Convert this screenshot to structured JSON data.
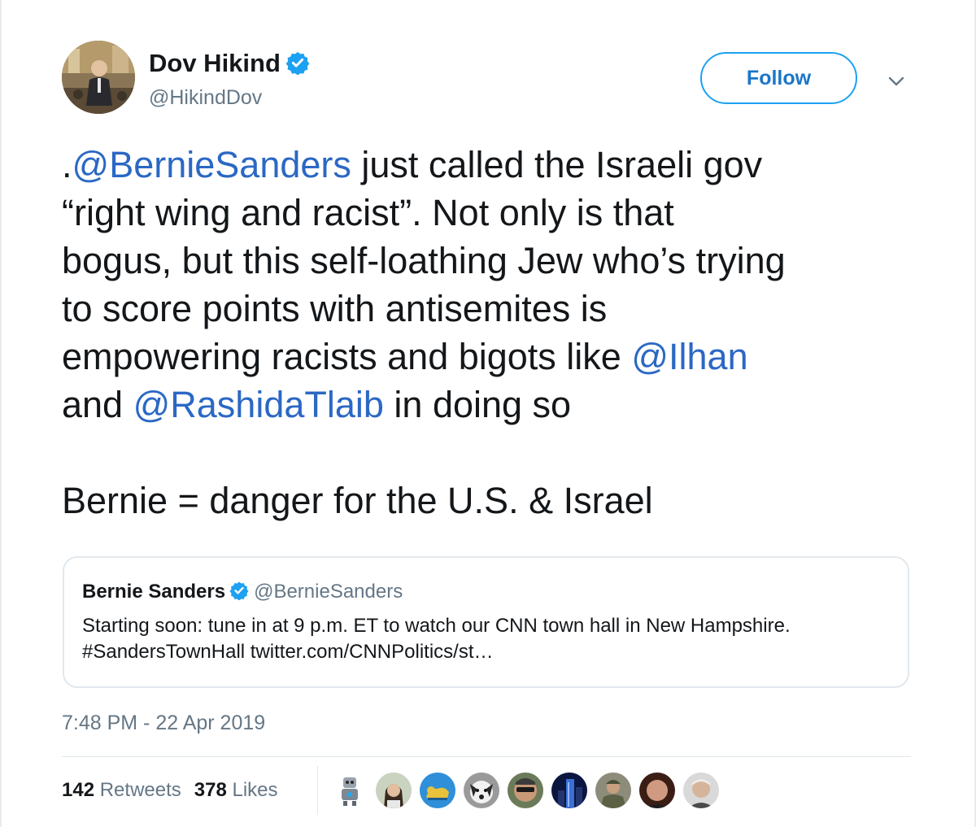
{
  "author": {
    "name": "Dov Hikind",
    "handle": "@HikindDov",
    "verified": true
  },
  "actions": {
    "follow_label": "Follow",
    "menu_icon": "chevron-down-icon"
  },
  "tweet": {
    "line1_prefix": ".",
    "line1_mention": "@BernieSanders",
    "line1_rest": " just called the Israeli gov",
    "line2": "“right wing and racist”. Not only is that",
    "line3": "bogus, but this self-loathing Jew who’s trying",
    "line4": "to score points with antisemites is",
    "line5_text": "empowering racists and bigots like ",
    "line5_mention": "@Ilhan",
    "line6_text": "and ",
    "line6_mention": "@RashidaTlaib",
    "line6_rest": " in doing so",
    "line7": "Bernie = danger for the U.S. & Israel"
  },
  "quote": {
    "name": "Bernie Sanders",
    "handle": "@BernieSanders",
    "verified": true,
    "line1": "Starting soon: tune in at 9 p.m. ET to watch our CNN town hall in New Hampshire.",
    "line2": "#SandersTownHall twitter.com/CNNPolitics/st…"
  },
  "timestamp": "7:48 PM - 22 Apr 2019",
  "stats": {
    "retweets_count": "142",
    "retweets_label": "Retweets",
    "likes_count": "378",
    "likes_label": "Likes"
  },
  "colors": {
    "link": "#2b68c4",
    "follow_border": "#1da1f2",
    "muted": "#657786",
    "verified": "#1da1f2"
  }
}
